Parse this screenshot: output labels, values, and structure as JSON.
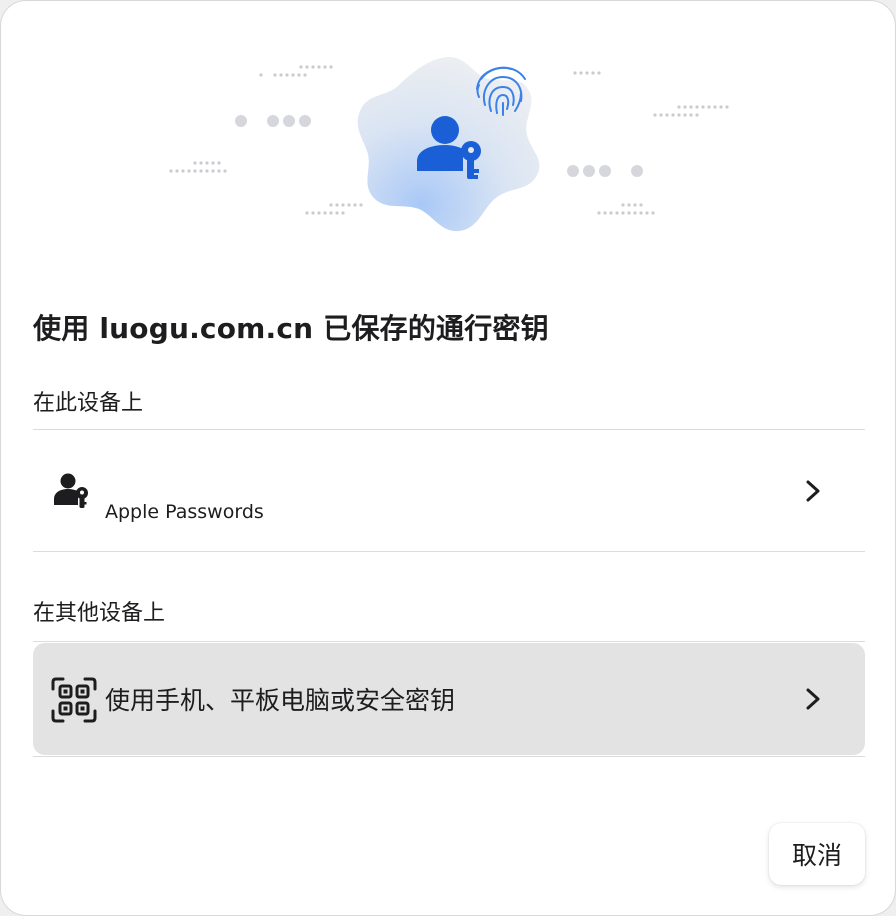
{
  "dialog": {
    "title": "使用 luogu.com.cn 已保存的通行密钥",
    "sections": [
      {
        "label": "在此设备上",
        "options": [
          {
            "label": "Apple Passwords",
            "icon": "person-key-icon"
          }
        ]
      },
      {
        "label": "在其他设备上",
        "options": [
          {
            "label": "使用手机、平板电脑或安全密钥",
            "icon": "qr-code-icon",
            "selected": true
          }
        ]
      }
    ],
    "cancel_label": "取消"
  },
  "colors": {
    "accent": "#1a5fd6",
    "selected_row": "#e3e3e3",
    "text": "#1d1d1f",
    "divider": "#dcdcdc"
  }
}
